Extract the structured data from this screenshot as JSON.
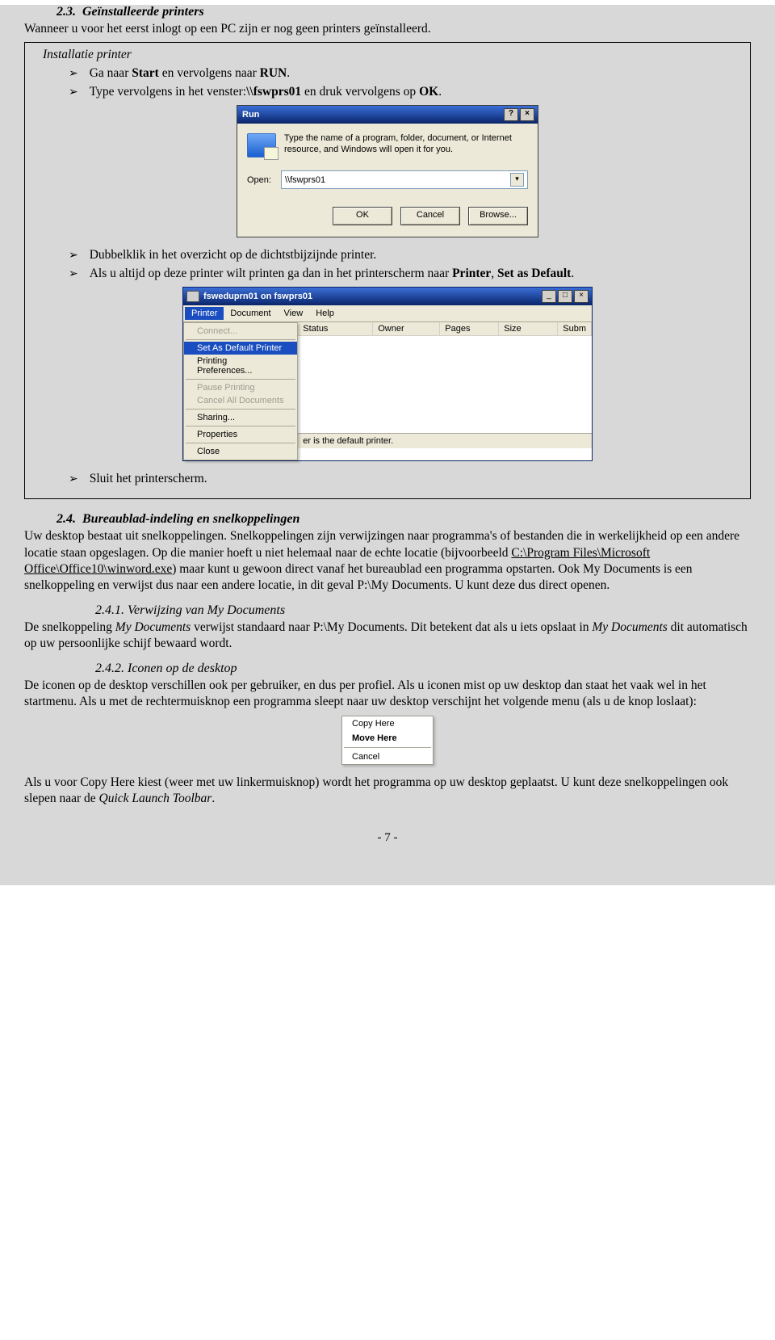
{
  "section23": {
    "num": "2.3.",
    "title": "Geïnstalleerde printers",
    "intro": "Wanneer u voor het eerst inlogt op een PC zijn er nog geen printers geïnstalleerd."
  },
  "box": {
    "title": "Installatie printer",
    "b1_pre": "Ga naar ",
    "b1_b1": "Start",
    "b1_mid": " en vervolgens naar ",
    "b1_b2": "RUN",
    "b1_suf": ".",
    "b2_pre": "Type vervolgens in het venster:",
    "b2_b1": "\\\\fswprs01",
    "b2_mid": " en druk vervolgens op ",
    "b2_b2": "OK",
    "b2_suf": ".",
    "b3": "Dubbelklik in het overzicht op de dichtstbijzijnde printer.",
    "b4_pre": "Als u altijd op deze printer wilt printen ga dan in het printerscherm naar ",
    "b4_b1": "Printer",
    "b4_mid": ", ",
    "b4_b2": "Set as Default",
    "b4_suf": ".",
    "b5": "Sluit het printerscherm."
  },
  "run": {
    "title": "Run",
    "desc": "Type the name of a program, folder, document, or Internet resource, and Windows will open it for you.",
    "open_label": "Open:",
    "open_value": "\\\\fswprs01",
    "btn_ok": "OK",
    "btn_cancel": "Cancel",
    "btn_browse": "Browse..."
  },
  "printerwin": {
    "title": "fsweduprn01 on fswprs01",
    "menu": [
      "Printer",
      "Document",
      "View",
      "Help"
    ],
    "dropdown": {
      "connect": "Connect...",
      "setdefault": "Set As Default Printer",
      "prefs": "Printing Preferences...",
      "pause": "Pause Printing",
      "cancelall": "Cancel All Documents",
      "sharing": "Sharing...",
      "properties": "Properties",
      "close": "Close"
    },
    "cols": [
      "Status",
      "Owner",
      "Pages",
      "Size",
      "Subm"
    ],
    "status": "er is the default printer."
  },
  "section24": {
    "num": "2.4.",
    "title": "Bureaublad-indeling en snelkoppelingen",
    "p1a": "Uw desktop bestaat uit snelkoppelingen. Snelkoppelingen zijn verwijzingen naar programma's of bestanden die in werkelijkheid op een andere locatie staan opgeslagen. Op die manier hoeft u niet helemaal naar de echte locatie (bijvoorbeeld ",
    "p1u": "C:\\Program Files\\Microsoft Office\\Office10\\winword.exe",
    "p1b": ") maar kunt u gewoon direct vanaf het bureaublad een programma opstarten. Ook My Documents is een snelkoppeling en verwijst dus naar een andere locatie, in dit geval P:\\My Documents. U kunt deze dus direct openen."
  },
  "section241": {
    "heading": "2.4.1. Verwijzing van My Documents",
    "p_a": "De snelkoppeling ",
    "p_i1": "My Documents",
    "p_b": " verwijst standaard naar P:\\My Documents. Dit betekent dat als u iets opslaat in ",
    "p_i2": "My Documents",
    "p_c": " dit automatisch op uw persoonlijke schijf bewaard wordt."
  },
  "section242": {
    "heading": "2.4.2. Iconen op de desktop",
    "p": "De iconen op de desktop verschillen ook per gebruiker, en dus per profiel. Als u iconen mist op uw desktop dan staat het vaak wel in het startmenu. Als u met de rechtermuisknop een programma sleept naar uw desktop verschijnt het volgende menu (als u de knop loslaat):"
  },
  "contextmenu": {
    "copy": "Copy Here",
    "move": "Move Here",
    "cancel": "Cancel"
  },
  "closing": {
    "a": "Als u voor Copy Here kiest (weer met uw linkermuisknop) wordt het programma op uw desktop geplaatst. U kunt deze snelkoppelingen ook slepen naar de ",
    "i": "Quick Launch Toolbar",
    "b": "."
  },
  "pagenum": "- 7 -"
}
